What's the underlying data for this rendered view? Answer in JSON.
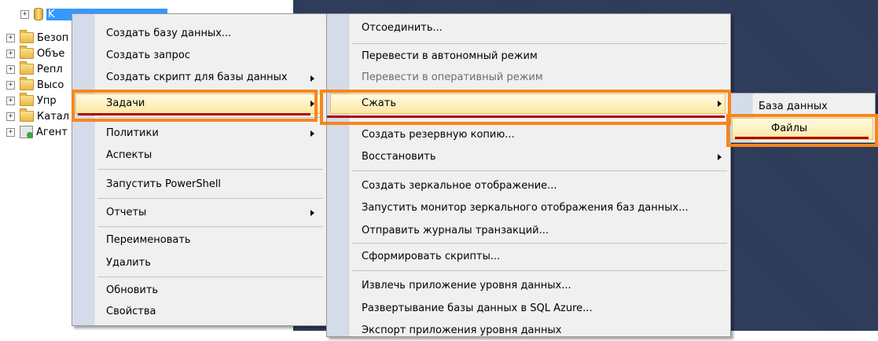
{
  "tree": {
    "server_label": "K",
    "items": [
      {
        "label": "Безоп",
        "icon": "folder-icon"
      },
      {
        "label": "Объе",
        "icon": "folder-icon"
      },
      {
        "label": "Репл",
        "icon": "folder-icon"
      },
      {
        "label": "Высо",
        "icon": "folder-icon"
      },
      {
        "label": "Упр",
        "icon": "folder-icon"
      },
      {
        "label": "Катал",
        "icon": "folder-icon"
      },
      {
        "label": "Агент",
        "icon": "agent-icon"
      }
    ],
    "expander_symbol": "+"
  },
  "menu1": {
    "items": [
      {
        "label": "Создать базу данных...",
        "submenu": false
      },
      {
        "label": "Создать запрос",
        "submenu": false
      },
      {
        "label": "Создать скрипт для базы данных",
        "submenu": true
      },
      {
        "label": "Задачи",
        "submenu": true,
        "highlighted": true
      },
      {
        "label": "Политики",
        "submenu": true
      },
      {
        "label": "Аспекты",
        "submenu": false
      },
      {
        "label": "Запустить PowerShell",
        "submenu": false
      },
      {
        "label": "Отчеты",
        "submenu": true
      },
      {
        "label": "Переименовать",
        "submenu": false
      },
      {
        "label": "Удалить",
        "submenu": false
      },
      {
        "label": "Обновить",
        "submenu": false
      },
      {
        "label": "Свойства",
        "submenu": false
      }
    ]
  },
  "menu2": {
    "items": [
      {
        "label": "Отсоединить...",
        "submenu": false
      },
      {
        "label": "Перевести в автономный режим",
        "submenu": false
      },
      {
        "label": "Перевести в оперативный режим",
        "submenu": false,
        "disabled": true
      },
      {
        "label": "Сжать",
        "submenu": true,
        "highlighted": true
      },
      {
        "label": "Создать резервную копию...",
        "submenu": false
      },
      {
        "label": "Восстановить",
        "submenu": true
      },
      {
        "label": "Создать зеркальное отображение...",
        "submenu": false
      },
      {
        "label": "Запустить монитор зеркального отображения баз данных...",
        "submenu": false
      },
      {
        "label": "Отправить журналы транзакций...",
        "submenu": false
      },
      {
        "label": "Сформировать скрипты...",
        "submenu": false
      },
      {
        "label": "Извлечь приложение уровня данных...",
        "submenu": false
      },
      {
        "label": "Развертывание базы данных в SQL Azure...",
        "submenu": false
      },
      {
        "label": "Экспорт приложения уровня данных",
        "submenu": false
      }
    ]
  },
  "menu3": {
    "items": [
      {
        "label": "База данных",
        "submenu": false
      },
      {
        "label": "Файлы",
        "submenu": false,
        "highlighted": true
      }
    ]
  },
  "colors": {
    "highlight_box": "#f7861d",
    "underline": "#b00000",
    "desktop": "#2b3958"
  }
}
